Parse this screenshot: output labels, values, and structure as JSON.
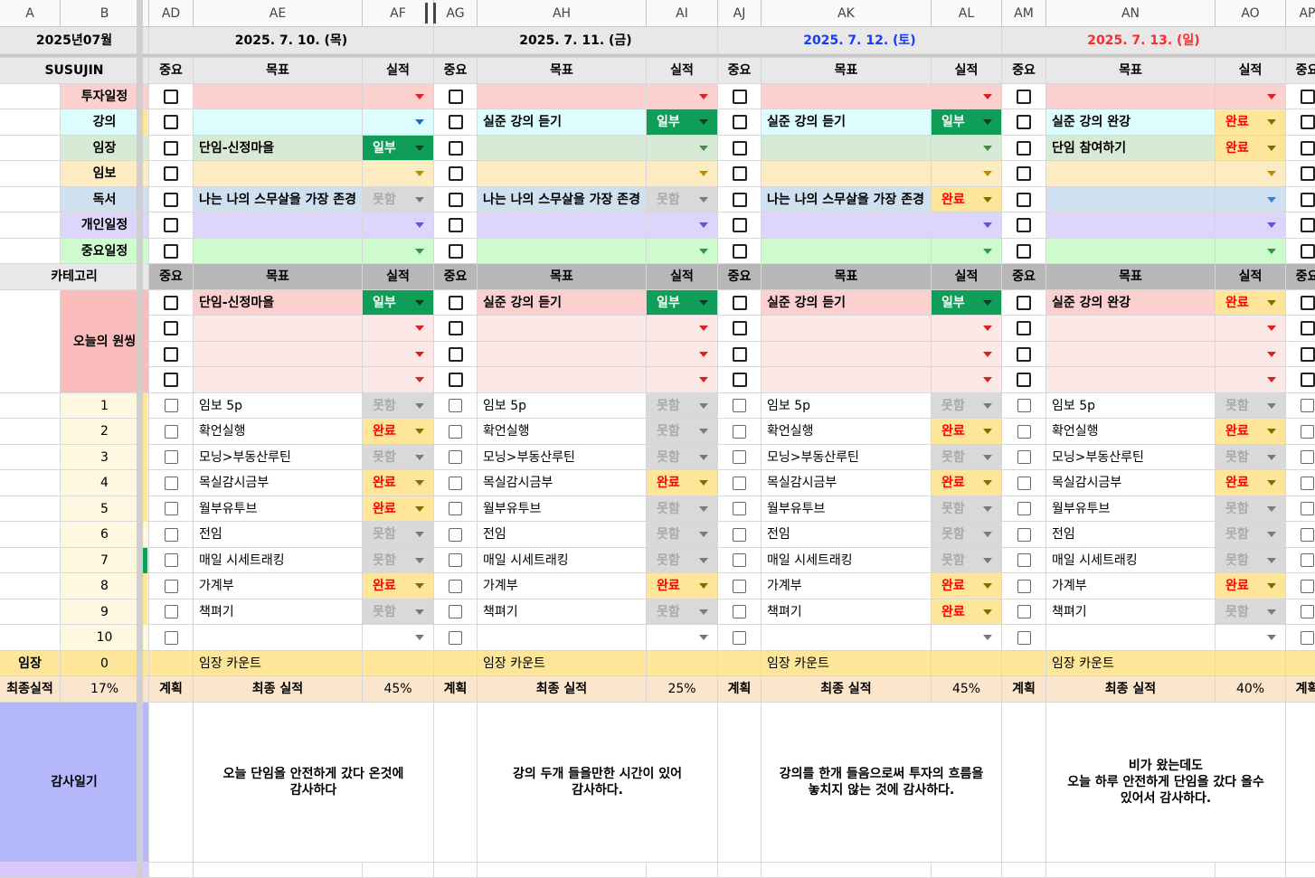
{
  "columns": [
    "A",
    "B",
    "AD",
    "AE",
    "AF",
    "AG",
    "AH",
    "AI",
    "AJ",
    "AK",
    "AL",
    "AM",
    "AN",
    "AO",
    "AP"
  ],
  "header": {
    "month": "2025년07월",
    "name": "SUSUJIN",
    "days": [
      {
        "date": "2025. 7. 10. (목)",
        "color": "#000000"
      },
      {
        "date": "2025. 7. 11. (금)",
        "color": "#000000"
      },
      {
        "date": "2025. 7. 12. (토)",
        "color": "#1a39ff"
      },
      {
        "date": "2025. 7. 13. (일)",
        "color": "#ff2a2a"
      }
    ]
  },
  "labels": {
    "importance": "중요",
    "goal": "목표",
    "result": "실적",
    "category": "카테고리",
    "wish": "오늘의 원씽",
    "imjang": "임장",
    "final": "최종실적",
    "plan": "계획",
    "final_result": "최종 실적",
    "imjang_count": "임장 카운트",
    "gratitude": "감사일기",
    "imjang_value": "0",
    "final_value": "17%"
  },
  "categories": [
    {
      "name": "투자일정",
      "bg": "#fdd0d0",
      "arrow": "#e02020"
    },
    {
      "name": "강의",
      "bg": "#dcfcfd",
      "arrow": "#1f6fbf"
    },
    {
      "name": "임장",
      "bg": "#d6ead5",
      "arrow": "#3f8f3f"
    },
    {
      "name": "임보",
      "bg": "#fdebc2",
      "arrow": "#c08a00"
    },
    {
      "name": "독서",
      "bg": "#cfe0f1",
      "arrow": "#3c7fc6"
    },
    {
      "name": "개인일정",
      "bg": "#ddd5fb",
      "arrow": "#6a4fd8"
    },
    {
      "name": "중요일정",
      "bg": "#cdfbcd",
      "arrow": "#2f9a3a"
    }
  ],
  "status": {
    "partial": {
      "label": "일부",
      "bg": "#0f9d58",
      "color": "#ffffff",
      "arrow": "#0b3d20"
    },
    "done": {
      "label": "완료",
      "bg": "#fde59a",
      "color": "#ff0000",
      "arrow": "#8a6a00"
    },
    "fail": {
      "label": "못함",
      "bg": "#d9d9d9",
      "color": "#aaaaaa",
      "arrow": "#7a7a7a"
    }
  },
  "days": [
    {
      "cat_rows": [
        {
          "goal": "",
          "status": ""
        },
        {
          "goal": "",
          "status": ""
        },
        {
          "goal": "단임-신정마을",
          "status": "partial"
        },
        {
          "goal": "",
          "status": ""
        },
        {
          "goal": "나는 나의 스무살을 가장 존경",
          "status": "fail"
        },
        {
          "goal": "",
          "status": ""
        },
        {
          "goal": "",
          "status": ""
        }
      ],
      "wish_rows": [
        {
          "goal": "단임-신정마을",
          "status": "partial"
        },
        {
          "goal": "",
          "status": ""
        },
        {
          "goal": "",
          "status": ""
        },
        {
          "goal": "",
          "status": ""
        }
      ],
      "statuses": [
        "fail",
        "done",
        "fail",
        "done",
        "done",
        "fail",
        "fail",
        "done",
        "fail",
        ""
      ],
      "final_pct": "45%",
      "gratitude": "오늘 단임을 안전하게 갔다 온것에\n감사하다"
    },
    {
      "cat_rows": [
        {
          "goal": "",
          "status": ""
        },
        {
          "goal": "실준 강의 듣기",
          "status": "partial"
        },
        {
          "goal": "",
          "status": ""
        },
        {
          "goal": "",
          "status": ""
        },
        {
          "goal": "나는 나의 스무살을 가장 존경",
          "status": "fail"
        },
        {
          "goal": "",
          "status": ""
        },
        {
          "goal": "",
          "status": ""
        }
      ],
      "wish_rows": [
        {
          "goal": "실준 강의 듣기",
          "status": "partial"
        },
        {
          "goal": "",
          "status": ""
        },
        {
          "goal": "",
          "status": ""
        },
        {
          "goal": "",
          "status": ""
        }
      ],
      "statuses": [
        "fail",
        "fail",
        "fail",
        "done",
        "fail",
        "fail",
        "fail",
        "done",
        "fail",
        ""
      ],
      "final_pct": "25%",
      "gratitude": "강의 두개 들을만한 시간이 있어\n감사하다."
    },
    {
      "cat_rows": [
        {
          "goal": "",
          "status": ""
        },
        {
          "goal": "실준 강의 듣기",
          "status": "partial"
        },
        {
          "goal": "",
          "status": ""
        },
        {
          "goal": "",
          "status": ""
        },
        {
          "goal": "나는 나의 스무살을 가장 존경",
          "status": "done"
        },
        {
          "goal": "",
          "status": ""
        },
        {
          "goal": "",
          "status": ""
        }
      ],
      "wish_rows": [
        {
          "goal": "실준 강의 듣기",
          "status": "partial"
        },
        {
          "goal": "",
          "status": ""
        },
        {
          "goal": "",
          "status": ""
        },
        {
          "goal": "",
          "status": ""
        }
      ],
      "statuses": [
        "fail",
        "done",
        "fail",
        "done",
        "fail",
        "fail",
        "fail",
        "done",
        "done",
        ""
      ],
      "final_pct": "45%",
      "gratitude": "강의를 한개 들음으로써 투자의 흐름을\n놓치지 않는 것에 감사하다."
    },
    {
      "cat_rows": [
        {
          "goal": "",
          "status": ""
        },
        {
          "goal": "실준 강의 완강",
          "status": "done"
        },
        {
          "goal": "단임 참여하기",
          "status": "done"
        },
        {
          "goal": "",
          "status": ""
        },
        {
          "goal": "",
          "status": ""
        },
        {
          "goal": "",
          "status": ""
        },
        {
          "goal": "",
          "status": ""
        }
      ],
      "wish_rows": [
        {
          "goal": "실준 강의 완강",
          "status": "done"
        },
        {
          "goal": "",
          "status": ""
        },
        {
          "goal": "",
          "status": ""
        },
        {
          "goal": "",
          "status": ""
        }
      ],
      "statuses": [
        "fail",
        "done",
        "fail",
        "done",
        "fail",
        "fail",
        "fail",
        "done",
        "fail",
        ""
      ],
      "final_pct": "40%",
      "gratitude": "비가  왔는데도\n오늘 하루 안전하게 단임을 갔다 올수\n있어서 감사하다."
    }
  ],
  "routines": [
    "임보 5p",
    "확언실행",
    "모닝>부동산루틴",
    "목실감시금부",
    "월부유투브",
    "전임",
    "매일 시세트래킹",
    "가계부",
    "책펴기",
    ""
  ],
  "routine_numbers": [
    "1",
    "2",
    "3",
    "4",
    "5",
    "6",
    "7",
    "8",
    "9",
    "10"
  ]
}
